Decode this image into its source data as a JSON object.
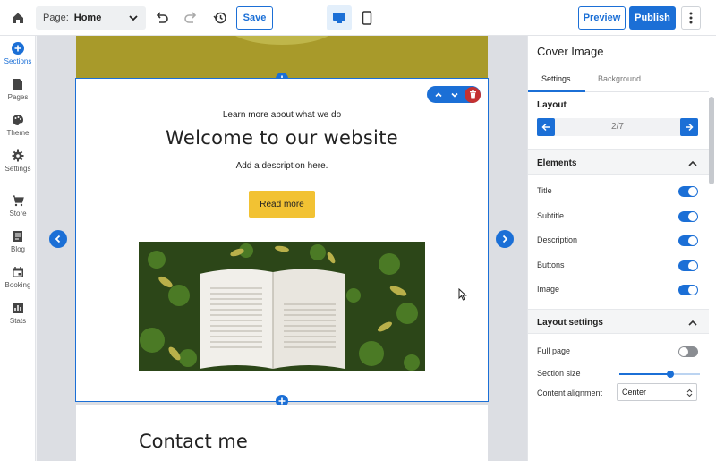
{
  "topbar": {
    "page_label": "Page:",
    "page_value": "Home",
    "save_label": "Save",
    "preview_label": "Preview",
    "publish_label": "Publish"
  },
  "leftnav": {
    "items": [
      {
        "label": "Sections",
        "icon": "plus-circle-icon",
        "active": true
      },
      {
        "label": "Pages",
        "icon": "page-icon"
      },
      {
        "label": "Theme",
        "icon": "palette-icon"
      },
      {
        "label": "Settings",
        "icon": "gear-icon"
      },
      {
        "label": "Store",
        "icon": "cart-icon"
      },
      {
        "label": "Blog",
        "icon": "blog-icon"
      },
      {
        "label": "Booking",
        "icon": "calendar-icon"
      },
      {
        "label": "Stats",
        "icon": "chart-icon"
      }
    ]
  },
  "canvas": {
    "eyebrow": "Learn more about what we do",
    "headline": "Welcome to our website",
    "description": "Add a description here.",
    "button_label": "Read more",
    "contact_title": "Contact me"
  },
  "panel": {
    "title": "Cover Image",
    "tabs": [
      "Settings",
      "Background"
    ],
    "layout_label": "Layout",
    "layout_value": "2/7",
    "elements_label": "Elements",
    "elements": [
      {
        "label": "Title",
        "on": true
      },
      {
        "label": "Subtitle",
        "on": true
      },
      {
        "label": "Description",
        "on": true
      },
      {
        "label": "Buttons",
        "on": true
      },
      {
        "label": "Image",
        "on": true
      }
    ],
    "layout_settings_label": "Layout settings",
    "full_page_label": "Full page",
    "full_page_on": false,
    "section_size_label": "Section size",
    "section_size_fraction": 0.63,
    "content_alignment_label": "Content alignment",
    "content_alignment_value": "Center"
  },
  "colors": {
    "accent": "#1b6fd6",
    "button_yellow": "#f2c233",
    "delete_red": "#c43131"
  }
}
